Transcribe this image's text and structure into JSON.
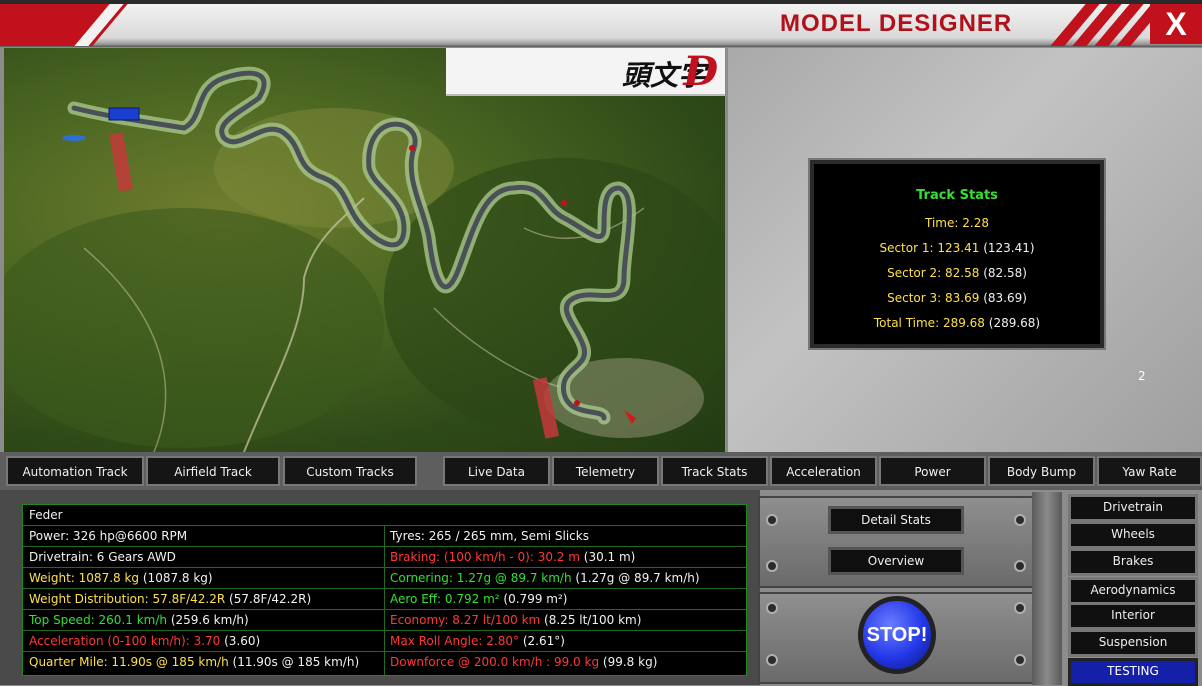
{
  "window": {
    "title": "MODEL DESIGNER",
    "close_label": "X"
  },
  "map": {
    "logo_text": "頭文字",
    "logo_letter": "D"
  },
  "track_stats": {
    "heading": "Track Stats",
    "time_label": "Time:",
    "time_value": "2.28",
    "sector1_label": "Sector 1:",
    "sector1_value": "123.41",
    "sector1_prev": "(123.41)",
    "sector2_label": "Sector 2:",
    "sector2_value": "82.58",
    "sector2_prev": "(82.58)",
    "sector3_label": "Sector 3:",
    "sector3_value": "83.69",
    "sector3_prev": "(83.69)",
    "total_label": "Total Time:",
    "total_value": "289.68",
    "total_prev": "(289.68)"
  },
  "side_number": "2",
  "track_tabs": [
    "Automation Track",
    "Airfield Track",
    "Custom Tracks"
  ],
  "data_tabs": [
    "Live Data",
    "Telemetry",
    "Track Stats",
    "Acceleration",
    "Power",
    "Body Bump",
    "Yaw Rate"
  ],
  "car": {
    "name": "Feder",
    "power": "Power: 326 hp@6600 RPM",
    "drivetrain": "Drivetrain: 6 Gears AWD",
    "weight": "Weight: 1087.8 kg",
    "weight_prev": "(1087.8 kg)",
    "weight_dist": "Weight Distribution: 57.8F/42.2R",
    "weight_dist_prev": "(57.8F/42.2R)",
    "top_speed": "Top Speed: 260.1 km/h",
    "top_speed_prev": "(259.6 km/h)",
    "acceleration": "Acceleration (0-100 km/h): 3.70",
    "acceleration_prev": "(3.60)",
    "quarter_mile": "Quarter Mile: 11.90s @ 185 km/h",
    "quarter_mile_prev": "(11.90s @ 185 km/h)",
    "tyres": "Tyres: 265 / 265 mm, Semi Slicks",
    "braking": "Braking: (100 km/h - 0): 30.2 m",
    "braking_prev": "(30.1 m)",
    "cornering": "Cornering: 1.27g @ 89.7 km/h",
    "cornering_prev": "(1.27g @ 89.7 km/h)",
    "aero": "Aero Eff: 0.792 m²",
    "aero_prev": "(0.799 m²)",
    "economy": "Economy: 8.27 lt/100 km",
    "economy_prev": "(8.25 lt/100 km)",
    "roll": "Max Roll Angle: 2.80°",
    "roll_prev": "(2.61°)",
    "downforce": "Downforce @ 200.0 km/h : 99.0 kg",
    "downforce_prev": "(99.8 kg)"
  },
  "controls": {
    "detail_stats": "Detail Stats",
    "overview": "Overview",
    "stop": "STOP!"
  },
  "side_menu": [
    "Drivetrain",
    "Wheels",
    "Brakes",
    "Aerodynamics",
    "Interior",
    "Suspension",
    "TESTING"
  ],
  "colors": {
    "accent_red": "#c0111c",
    "stop_blue": "#2337e8",
    "stat_green": "#33e033",
    "stat_yellow": "#ffe04a",
    "stat_red": "#ff3838"
  }
}
